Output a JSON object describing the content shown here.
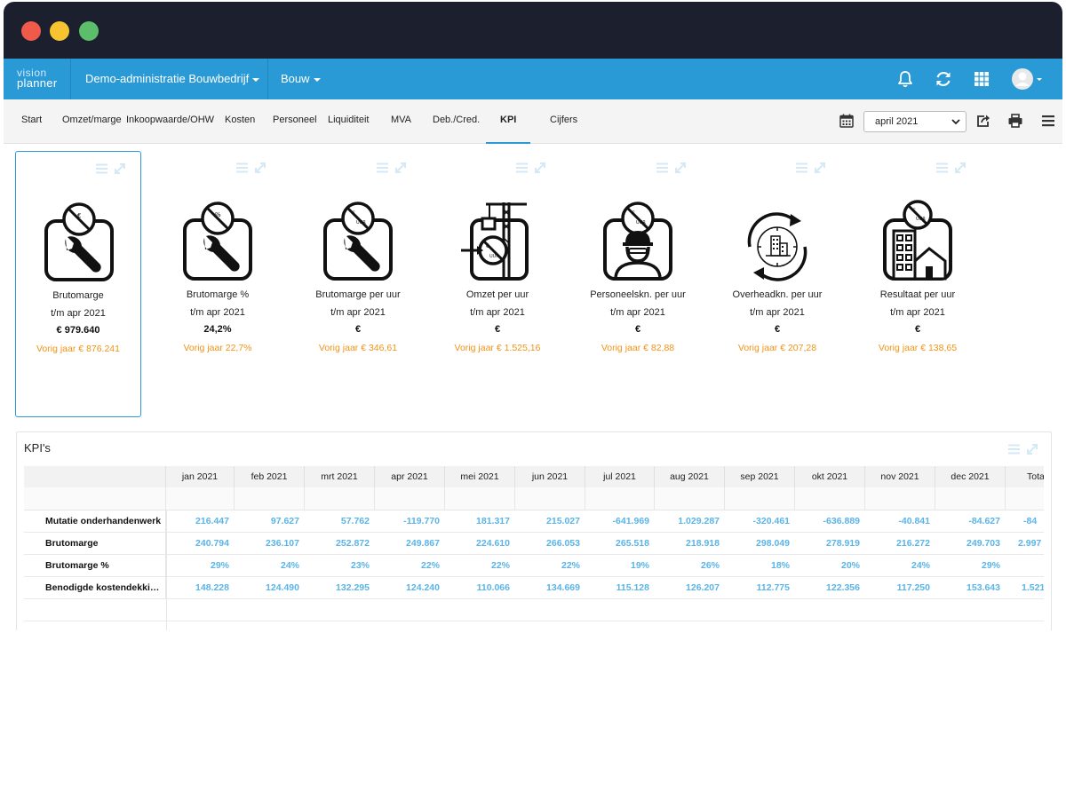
{
  "app": {
    "logo_top": "vision",
    "logo_bottom": "planner",
    "administration": "Demo-administratie Bouwbedrijf",
    "module": "Bouw"
  },
  "colors": {
    "accent": "#2a9ad6",
    "titlebar": "#1c1f2e",
    "previous_year": "#f29314",
    "table_value": "#5ab4e8"
  },
  "icons": [
    "bell-icon",
    "refresh-icon",
    "apps-grid-icon",
    "user-avatar-icon",
    "calendar-icon",
    "export-icon",
    "print-icon",
    "menu-icon",
    "list-icon",
    "expand-icon"
  ],
  "tabs": [
    {
      "label": "Start"
    },
    {
      "label": "Omzet/marge"
    },
    {
      "label": "Inkoopwaarde/OHW"
    },
    {
      "label": "Kosten"
    },
    {
      "label": "Personeel"
    },
    {
      "label": "Liquiditeit"
    },
    {
      "label": "MVA"
    },
    {
      "label": "Deb./Cred."
    },
    {
      "label": "KPI"
    },
    {
      "label": "Cijfers"
    }
  ],
  "active_tab": "KPI",
  "period_select": {
    "value": "april 2021"
  },
  "cards": [
    {
      "title": "Brutomarge",
      "period": "t/m apr 2021",
      "value": "€ 979.640",
      "previous": "Vorig jaar € 876.241",
      "icon": "wrench-euro-icon"
    },
    {
      "title": "Brutomarge %",
      "period": "t/m apr 2021",
      "value": "24,2%",
      "previous": "Vorig jaar  22,7%",
      "icon": "wrench-percent-icon"
    },
    {
      "title": "Brutomarge per uur",
      "period": "t/m apr 2021",
      "value": "€",
      "previous": "Vorig jaar € 346,61",
      "icon": "wrench-euro-hour-icon"
    },
    {
      "title": "Omzet per uur",
      "period": "t/m apr 2021",
      "value": "€",
      "previous": "Vorig jaar  € 1.525,16",
      "icon": "crane-revenue-icon"
    },
    {
      "title": "Personeelskn. per uur",
      "period": "t/m apr 2021",
      "value": "€",
      "previous": "Vorig jaar  € 82,88",
      "icon": "worker-cost-icon"
    },
    {
      "title": "Overheadkn. per uur",
      "period": "t/m apr 2021",
      "value": "€",
      "previous": "Vorig jaar  € 207,28",
      "icon": "overhead-cycle-icon"
    },
    {
      "title": "Resultaat per uur",
      "period": "t/m apr 2021",
      "value": "€",
      "previous": "Vorig jaar  € 138,65",
      "icon": "building-result-icon"
    }
  ],
  "kpi_table": {
    "title": "KPI's",
    "columns": [
      "jan 2021",
      "feb 2021",
      "mrt 2021",
      "apr 2021",
      "mei 2021",
      "jun 2021",
      "jul 2021",
      "aug 2021",
      "sep 2021",
      "okt 2021",
      "nov 2021",
      "dec 2021",
      "Totaa"
    ],
    "rows": [
      {
        "label": "Mutatie onderhandenwerk",
        "values": [
          "216.447",
          "97.627",
          "57.762",
          "-119.770",
          "181.317",
          "215.027",
          "-641.969",
          "1.029.287",
          "-320.461",
          "-636.889",
          "-40.841",
          "-84.627",
          "-84"
        ]
      },
      {
        "label": "Brutomarge",
        "values": [
          "240.794",
          "236.107",
          "252.872",
          "249.867",
          "224.610",
          "266.053",
          "265.518",
          "218.918",
          "298.049",
          "278.919",
          "216.272",
          "249.703",
          "2.997"
        ]
      },
      {
        "label": "Brutomarge %",
        "values": [
          "29%",
          "24%",
          "23%",
          "22%",
          "22%",
          "22%",
          "19%",
          "26%",
          "18%",
          "20%",
          "24%",
          "29%",
          ""
        ]
      },
      {
        "label": "Benodigde kostendekki…",
        "values": [
          "148.228",
          "124.490",
          "132.295",
          "124.240",
          "110.066",
          "134.669",
          "115.128",
          "126.207",
          "112.775",
          "122.356",
          "117.250",
          "153.643",
          "1.521"
        ]
      }
    ]
  }
}
